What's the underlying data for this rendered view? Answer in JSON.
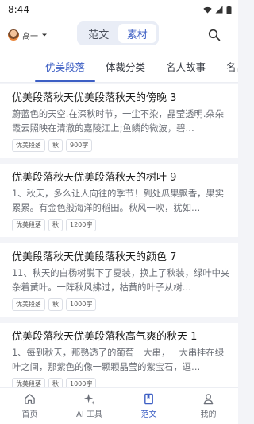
{
  "status": {
    "time": "8:44"
  },
  "header": {
    "user_name": "高一",
    "segments": [
      {
        "label": "范文",
        "active": false
      },
      {
        "label": "素材",
        "active": true
      }
    ]
  },
  "tabs": [
    {
      "label": "优美段落",
      "active": true
    },
    {
      "label": "体裁分类",
      "active": false
    },
    {
      "label": "名人故事",
      "active": false
    },
    {
      "label": "名言",
      "active": false
    }
  ],
  "cards": [
    {
      "title": "优美段落秋天优美段落秋天的傍晚 3",
      "body": "蔚蓝色的天空.在深秋时节，一尘不染，晶莹透明.朵朵霞云照映在清澈的嘉陵江上;鱼鳞的微波，碧…",
      "tags": [
        "优美段落",
        "秋",
        "900字"
      ]
    },
    {
      "title": "优美段落秋天优美段落秋天的树叶 9",
      "body": "1、秋天，多么让人向往的季节！到处瓜果飘香，果实累累。有金色般海洋的稻田。秋风一吹，犹如…",
      "tags": [
        "优美段落",
        "秋",
        "1200字"
      ]
    },
    {
      "title": "优美段落秋天优美段落秋天的颜色 7",
      "body": "11、秋天的白杨树脱下了夏装，换上了秋装，绿叶中夹杂着黄叶。一阵秋风拂过，枯黄的叶子从树…",
      "tags": [
        "优美段落",
        "秋",
        "1000字"
      ]
    },
    {
      "title": "优美段落秋天优美段落秋高气爽的秋天 1",
      "body": "1、每到秋天，那熟透了的葡萄一大串，一大串挂在绿叶之间，那紫色的像一颗颗晶莹的紫宝石，逗…",
      "tags": [
        "优美段落",
        "秋",
        "1000字"
      ]
    }
  ],
  "nav": [
    {
      "label": "首页",
      "icon": "home-icon",
      "active": false
    },
    {
      "label": "AI 工具",
      "icon": "sparkle-icon",
      "active": false
    },
    {
      "label": "范文",
      "icon": "book-icon",
      "active": true
    },
    {
      "label": "我的",
      "icon": "person-icon",
      "active": false
    }
  ],
  "colors": {
    "accent": "#3d5fc4",
    "background": "#f3f4f8"
  }
}
